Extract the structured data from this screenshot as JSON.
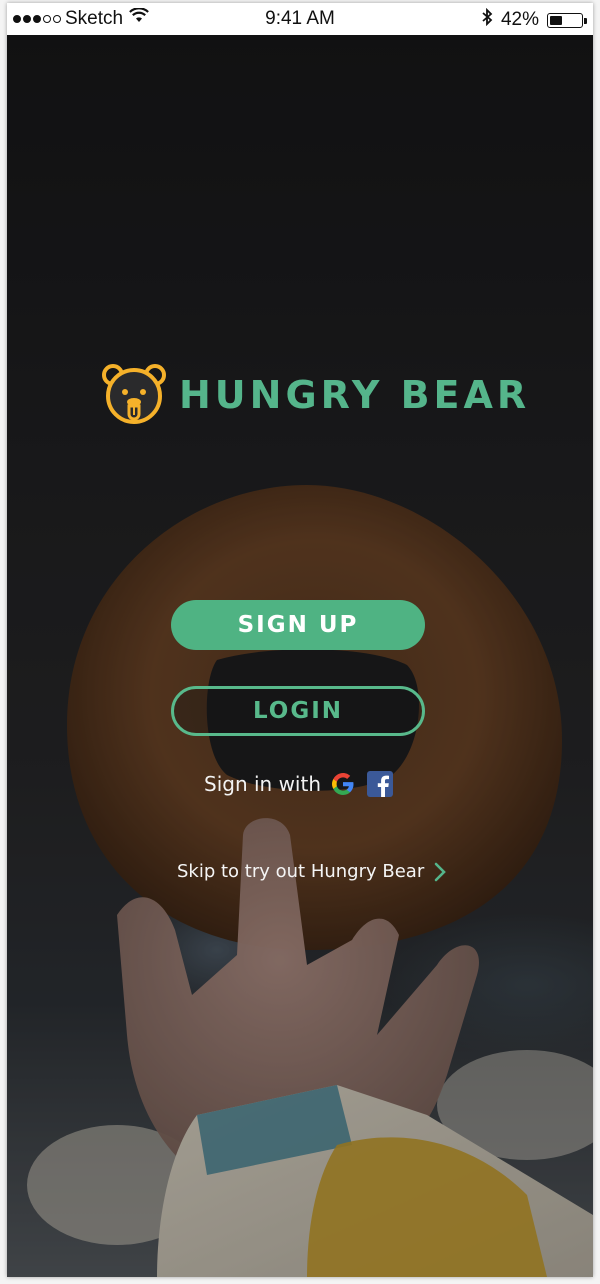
{
  "status_bar": {
    "carrier": "Sketch",
    "time": "9:41 AM",
    "battery_percent": "42%",
    "battery_level": 0.42,
    "signal_bars_filled": 3,
    "signal_bars_total": 5
  },
  "brand": {
    "name": "HUNGRY BEAR",
    "logo_icon": "bear-face-icon",
    "accent_color": "#55b58b",
    "logo_color": "#f5b12a"
  },
  "actions": {
    "signup_label": "SIGN UP",
    "login_label": "LOGIN"
  },
  "social": {
    "label": "Sign in with",
    "providers": [
      "google-icon",
      "facebook-icon"
    ]
  },
  "skip": {
    "label": "Skip to try out Hungry Bear"
  }
}
